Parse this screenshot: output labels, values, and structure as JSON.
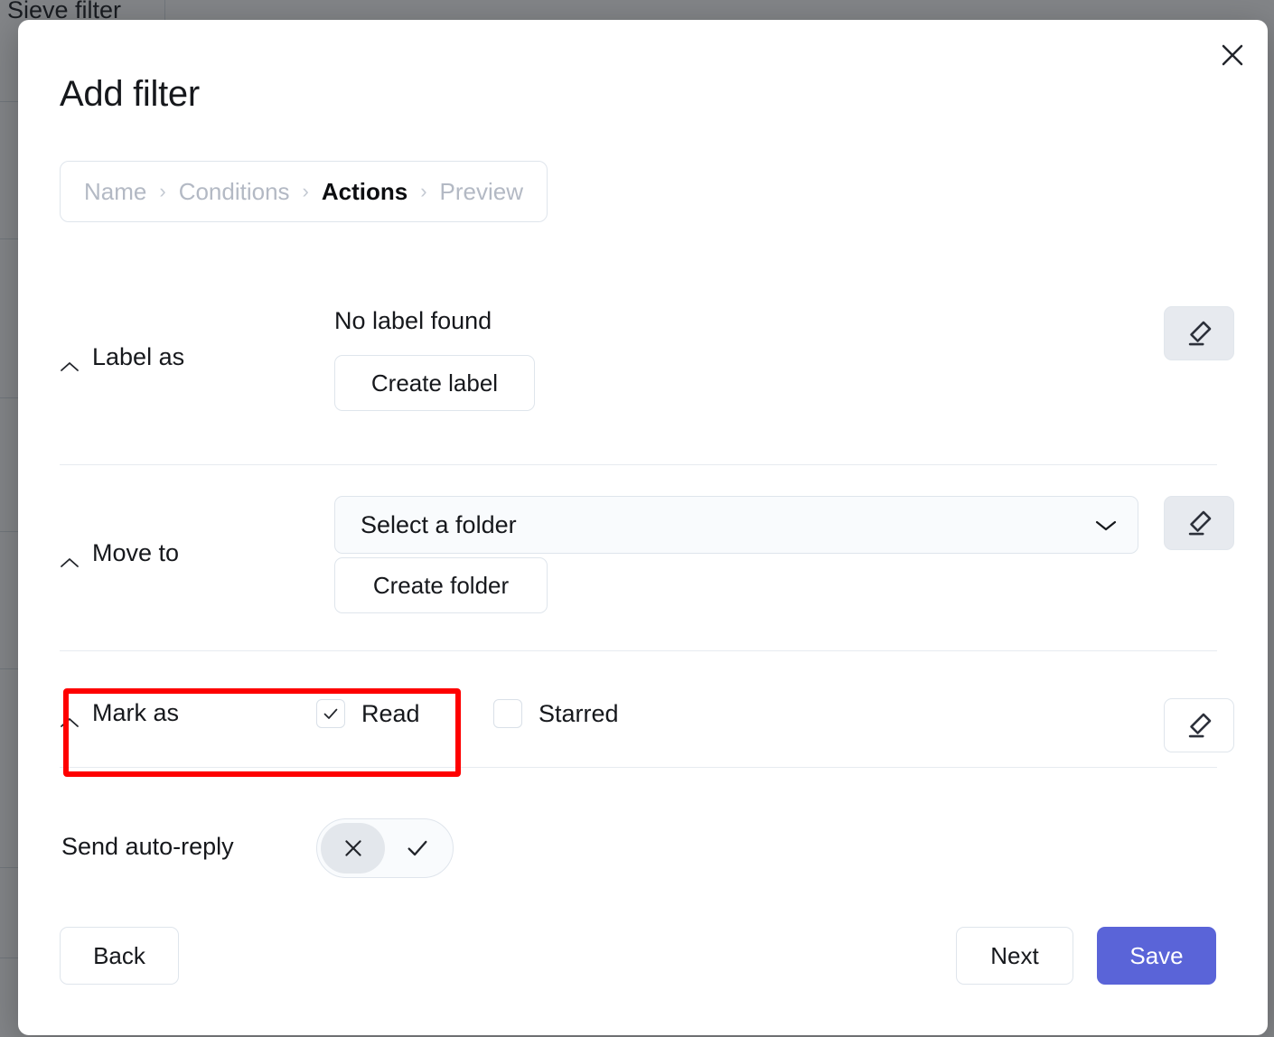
{
  "background": {
    "page_title": "Sieve filter"
  },
  "modal": {
    "title": "Add filter",
    "close_icon": "close-icon",
    "breadcrumb": {
      "separator": "›",
      "steps": [
        {
          "label": "Name",
          "active": false
        },
        {
          "label": "Conditions",
          "active": false
        },
        {
          "label": "Actions",
          "active": true
        },
        {
          "label": "Preview",
          "active": false
        }
      ]
    },
    "sections": {
      "label_as": {
        "title": "Label as",
        "collapse_icon": "chevron-up-icon",
        "empty_text": "No label found",
        "create_button": "Create label",
        "clear_icon": "eraser-icon",
        "clear_enabled": false
      },
      "move_to": {
        "title": "Move to",
        "collapse_icon": "chevron-up-icon",
        "select_value": "Select a folder",
        "select_chevron_icon": "chevron-down-icon",
        "create_button": "Create folder",
        "clear_icon": "eraser-icon",
        "clear_enabled": false
      },
      "mark_as": {
        "title": "Mark as",
        "collapse_icon": "chevron-up-icon",
        "options": [
          {
            "label": "Read",
            "checked": true
          },
          {
            "label": "Starred",
            "checked": false
          }
        ],
        "clear_icon": "eraser-icon",
        "clear_enabled": true,
        "highlighted": true,
        "highlight_color": "#fe0000"
      },
      "auto_reply": {
        "title": "Send auto-reply",
        "off_icon": "x-icon",
        "on_icon": "check-icon",
        "selected": "off"
      }
    },
    "footer": {
      "back_label": "Back",
      "next_label": "Next",
      "save_label": "Save",
      "save_color": "#5a64d8"
    }
  }
}
